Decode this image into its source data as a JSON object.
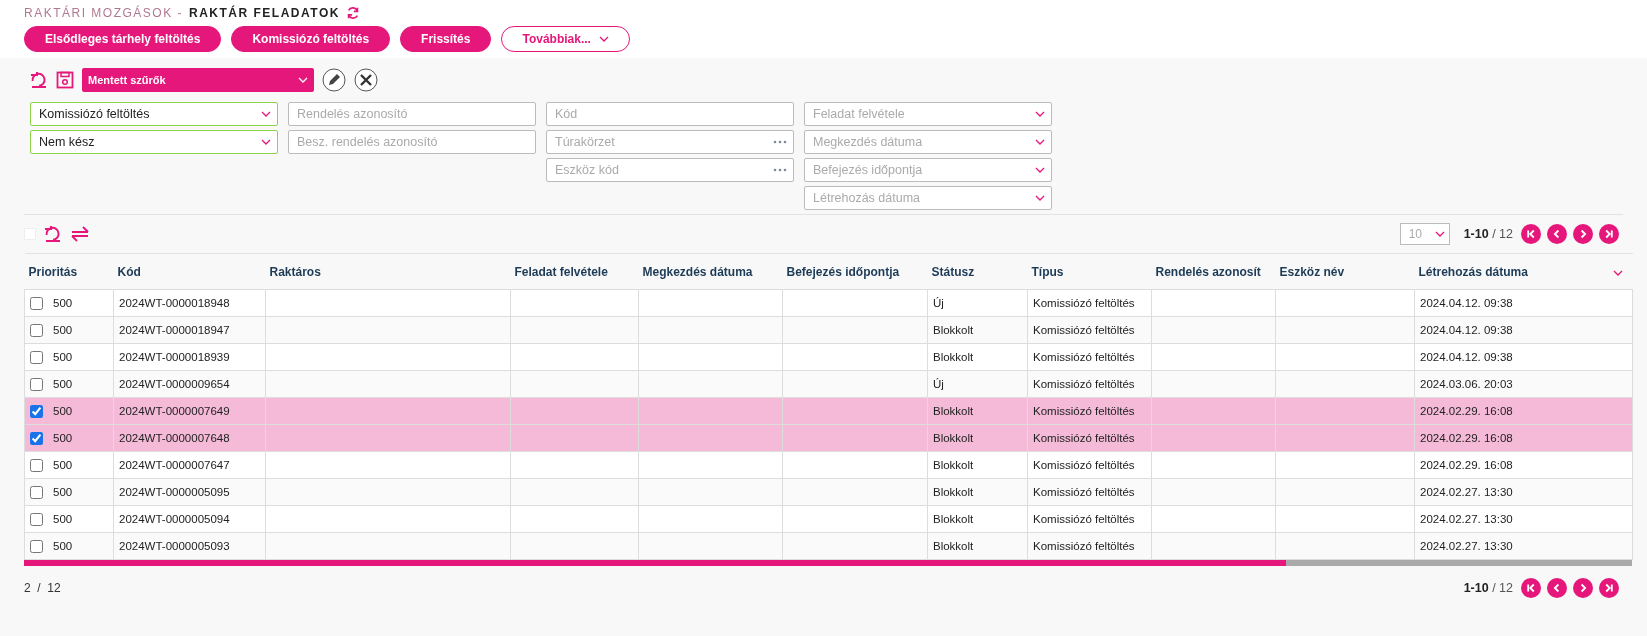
{
  "breadcrumb": {
    "parent": "RAKTÁRI MOZGÁSOK -",
    "current": "RAKTÁR FELADATOK"
  },
  "actions": [
    {
      "label": "Elsődleges tárhely feltöltés",
      "kind": "filled"
    },
    {
      "label": "Komissiózó feltöltés",
      "kind": "filled"
    },
    {
      "label": "Frissítés",
      "kind": "filled"
    },
    {
      "label": "Továbbiak...",
      "kind": "outline"
    }
  ],
  "saved_filters": {
    "label": "Mentett szűrők"
  },
  "filters": [
    [
      {
        "kind": "select",
        "value": "Komissiózó feltöltés"
      },
      {
        "kind": "select",
        "value": "Nem kész"
      }
    ],
    [
      {
        "kind": "text",
        "placeholder": "Rendelés azonosító"
      },
      {
        "kind": "text",
        "placeholder": "Besz. rendelés azonosító"
      }
    ],
    [
      {
        "kind": "text",
        "placeholder": "Kód"
      },
      {
        "kind": "lookup",
        "placeholder": "Túrakörzet"
      },
      {
        "kind": "lookup",
        "placeholder": "Eszköz kód"
      }
    ],
    [
      {
        "kind": "select",
        "placeholder": "Feladat felvétele"
      },
      {
        "kind": "select",
        "placeholder": "Megkezdés dátuma"
      },
      {
        "kind": "select",
        "placeholder": "Befejezés időpontja"
      },
      {
        "kind": "select",
        "placeholder": "Létrehozás dátuma"
      }
    ]
  ],
  "select_all": {
    "checked": false
  },
  "pagination_top": {
    "page_size": "10",
    "range": "**1-10** / 12"
  },
  "table": {
    "columns": [
      "Prioritás",
      "Kód",
      "Raktáros",
      "Feladat felvétele",
      "Megkezdés dátuma",
      "Befejezés időpontja",
      "Státusz",
      "Típus",
      "Rendelés azonosít",
      "Eszköz név",
      "Létrehozás dátuma"
    ],
    "rows": [
      {
        "selected": false,
        "cells": [
          "500",
          "2024WT-0000018948",
          "",
          "",
          "",
          "",
          "Új",
          "Komissiózó feltöltés",
          "",
          "",
          "2024.04.12. 09:38"
        ]
      },
      {
        "selected": false,
        "cells": [
          "500",
          "2024WT-0000018947",
          "",
          "",
          "",
          "",
          "Blokkolt",
          "Komissiózó feltöltés",
          "",
          "",
          "2024.04.12. 09:38"
        ]
      },
      {
        "selected": false,
        "cells": [
          "500",
          "2024WT-0000018939",
          "",
          "",
          "",
          "",
          "Blokkolt",
          "Komissiózó feltöltés",
          "",
          "",
          "2024.04.12. 09:38"
        ]
      },
      {
        "selected": false,
        "cells": [
          "500",
          "2024WT-0000009654",
          "",
          "",
          "",
          "",
          "Új",
          "Komissiózó feltöltés",
          "",
          "",
          "2024.03.06. 20:03"
        ]
      },
      {
        "selected": true,
        "cells": [
          "500",
          "2024WT-0000007649",
          "",
          "",
          "",
          "",
          "Blokkolt",
          "Komissiózó feltöltés",
          "",
          "",
          "2024.02.29. 16:08"
        ]
      },
      {
        "selected": true,
        "cells": [
          "500",
          "2024WT-0000007648",
          "",
          "",
          "",
          "",
          "Blokkolt",
          "Komissiózó feltöltés",
          "",
          "",
          "2024.02.29. 16:08"
        ]
      },
      {
        "selected": false,
        "cells": [
          "500",
          "2024WT-0000007647",
          "",
          "",
          "",
          "",
          "Blokkolt",
          "Komissiózó feltöltés",
          "",
          "",
          "2024.02.29. 16:08"
        ]
      },
      {
        "selected": false,
        "cells": [
          "500",
          "2024WT-0000005095",
          "",
          "",
          "",
          "",
          "Blokkolt",
          "Komissiózó feltöltés",
          "",
          "",
          "2024.02.27. 13:30"
        ]
      },
      {
        "selected": false,
        "cells": [
          "500",
          "2024WT-0000005094",
          "",
          "",
          "",
          "",
          "Blokkolt",
          "Komissiózó feltöltés",
          "",
          "",
          "2024.02.27. 13:30"
        ]
      },
      {
        "selected": false,
        "cells": [
          "500",
          "2024WT-0000005093",
          "",
          "",
          "",
          "",
          "Blokkolt",
          "Komissiózó feltöltés",
          "",
          "",
          "2024.02.27. 13:30"
        ]
      }
    ]
  },
  "footer": {
    "selection": "2  /  12",
    "range": "**1-10** / 12"
  }
}
